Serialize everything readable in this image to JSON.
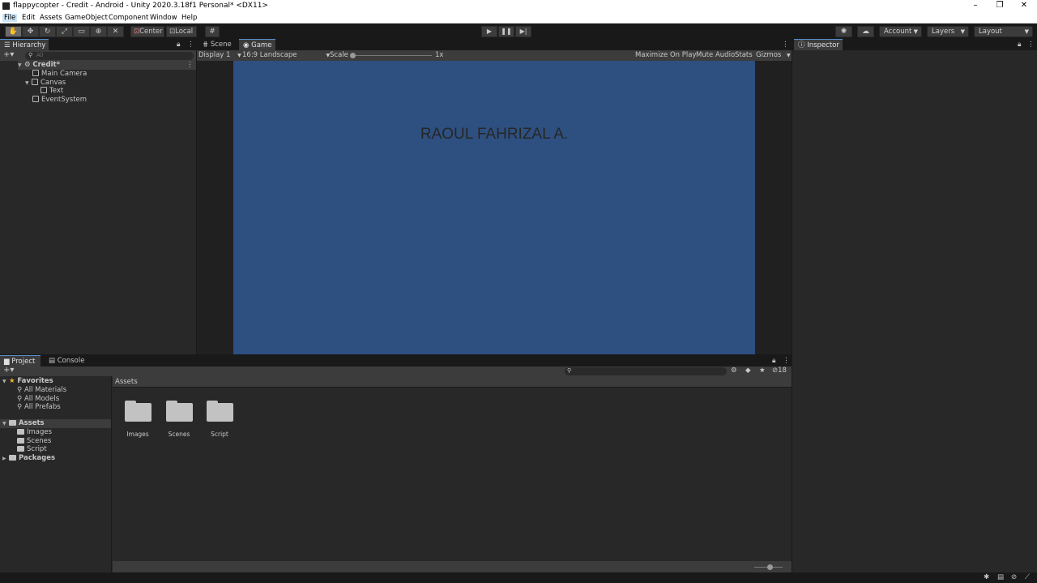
{
  "window": {
    "title": "flappycopter - Credit - Android - Unity 2020.3.18f1 Personal* <DX11>"
  },
  "menu": [
    "File",
    "Edit",
    "Assets",
    "GameObject",
    "Component",
    "Window",
    "Help"
  ],
  "toolbar": {
    "center_label": "Center",
    "local_label": "Local",
    "account_label": "Account",
    "layers_label": "Layers",
    "layout_label": "Layout"
  },
  "hierarchy": {
    "tab": "Hierarchy",
    "search_placeholder": "All",
    "scene_name": "Credit*",
    "items": [
      "Main Camera",
      "Canvas",
      "Text",
      "EventSystem"
    ]
  },
  "views": {
    "scene_tab": "Scene",
    "game_tab": "Game",
    "display": "Display 1",
    "aspect": "16:9 Landscape",
    "scale_label": "Scale",
    "scale_value": "1x",
    "maximize_label": "Maximize On Play",
    "mute_label": "Mute Audio",
    "stats_label": "Stats",
    "gizmos_label": "Gizmos",
    "game_text": "RAOUL FAHRIZAL A.",
    "game_bg": "#2e5080"
  },
  "inspector": {
    "tab": "Inspector"
  },
  "project": {
    "project_tab": "Project",
    "console_tab": "Console",
    "favorites_label": "Favorites",
    "favorites": [
      "All Materials",
      "All Models",
      "All Prefabs"
    ],
    "assets_label": "Assets",
    "asset_folders": [
      "Images",
      "Scenes",
      "Script"
    ],
    "packages_label": "Packages",
    "breadcrumb": "Assets",
    "grid_items": [
      "Images",
      "Scenes",
      "Script"
    ],
    "hidden_count": "18"
  },
  "colors": {
    "accent": "#5a8fd0",
    "panel": "#282828",
    "chrome": "#191919"
  }
}
